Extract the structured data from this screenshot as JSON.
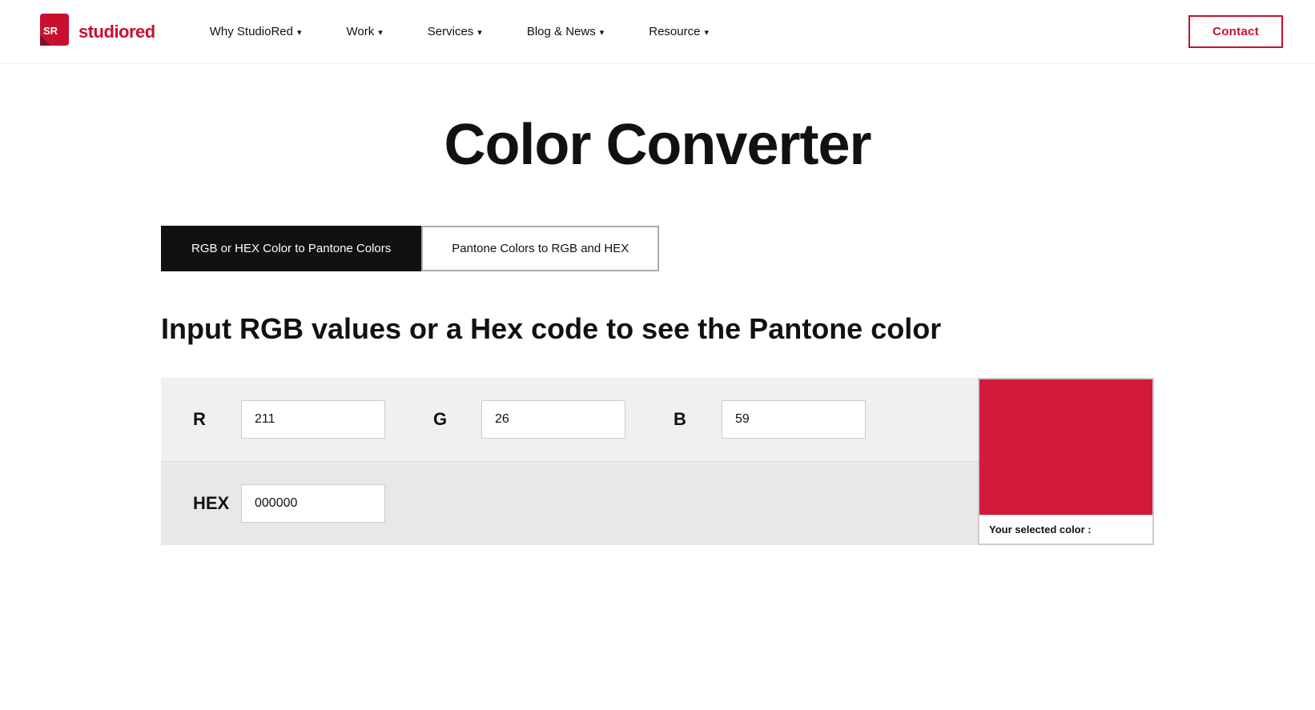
{
  "logo": {
    "name_studio": "studio",
    "name_red": "red"
  },
  "nav": {
    "items": [
      {
        "label": "Why StudioRed",
        "hasDropdown": true
      },
      {
        "label": "Work",
        "hasDropdown": true
      },
      {
        "label": "Services",
        "hasDropdown": true
      },
      {
        "label": "Blog & News",
        "hasDropdown": true
      },
      {
        "label": "Resource",
        "hasDropdown": true
      }
    ],
    "contact_label": "Contact"
  },
  "page": {
    "title": "Color Converter",
    "subtitle": "Input RGB values or a Hex code to see the Pantone color"
  },
  "tabs": {
    "active": {
      "label": "RGB or HEX Color to Pantone Colors"
    },
    "inactive": {
      "label": "Pantone Colors to RGB and HEX"
    }
  },
  "inputs": {
    "r_label": "R",
    "g_label": "G",
    "b_label": "B",
    "hex_label": "HEX",
    "r_value": "211",
    "g_value": "26",
    "b_value": "59",
    "hex_value": "000000"
  },
  "preview": {
    "label": "Your selected color :"
  }
}
